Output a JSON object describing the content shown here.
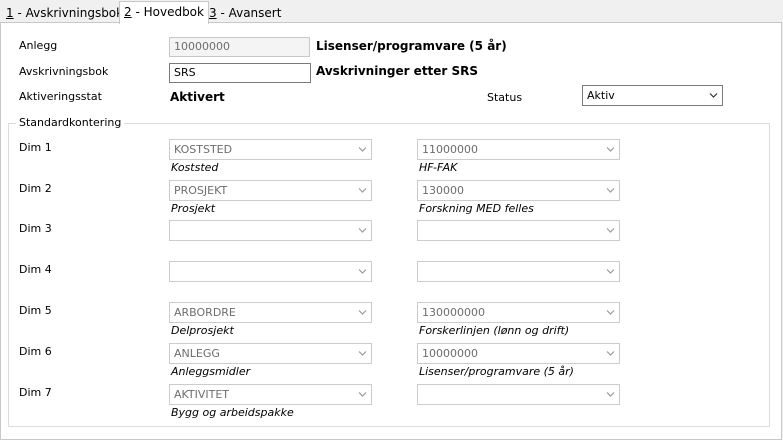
{
  "tabs": [
    {
      "num": "1",
      "label": " - Avskrivningsbok"
    },
    {
      "num": "2",
      "label": " - Hovedbok"
    },
    {
      "num": "3",
      "label": " - Avansert"
    }
  ],
  "form": {
    "anlegg_label": "Anlegg",
    "anlegg_value": "10000000",
    "anlegg_desc": "Lisenser/programvare (5 år)",
    "bok_label": "Avskrivningsbok",
    "bok_value": "SRS",
    "bok_desc": "Avskrivninger etter SRS",
    "akt_label": "Aktiveringsstat",
    "akt_value": "Aktivert",
    "status_label": "Status",
    "status_value": "Aktiv"
  },
  "group_title": "Standardkontering",
  "dims": [
    {
      "label": "Dim 1",
      "code": "KOSTSTED",
      "code_desc": "Koststed",
      "value": "11000000",
      "value_desc": "HF-FAK"
    },
    {
      "label": "Dim 2",
      "code": "PROSJEKT",
      "code_desc": "Prosjekt",
      "value": "130000",
      "value_desc": "Forskning MED felles"
    },
    {
      "label": "Dim 3",
      "code": "",
      "code_desc": "",
      "value": "",
      "value_desc": ""
    },
    {
      "label": "Dim 4",
      "code": "",
      "code_desc": "",
      "value": "",
      "value_desc": ""
    },
    {
      "label": "Dim 5",
      "code": "ARBORDRE",
      "code_desc": "Delprosjekt",
      "value": "130000000",
      "value_desc": "Forskerlinjen (lønn og drift)"
    },
    {
      "label": "Dim 6",
      "code": "ANLEGG",
      "code_desc": "Anleggsmidler",
      "value": "10000000",
      "value_desc": "Lisenser/programvare (5 år)"
    },
    {
      "label": "Dim 7",
      "code": "AKTIVITET",
      "code_desc": "Bygg og arbeidspakke",
      "value": "",
      "value_desc": ""
    }
  ]
}
